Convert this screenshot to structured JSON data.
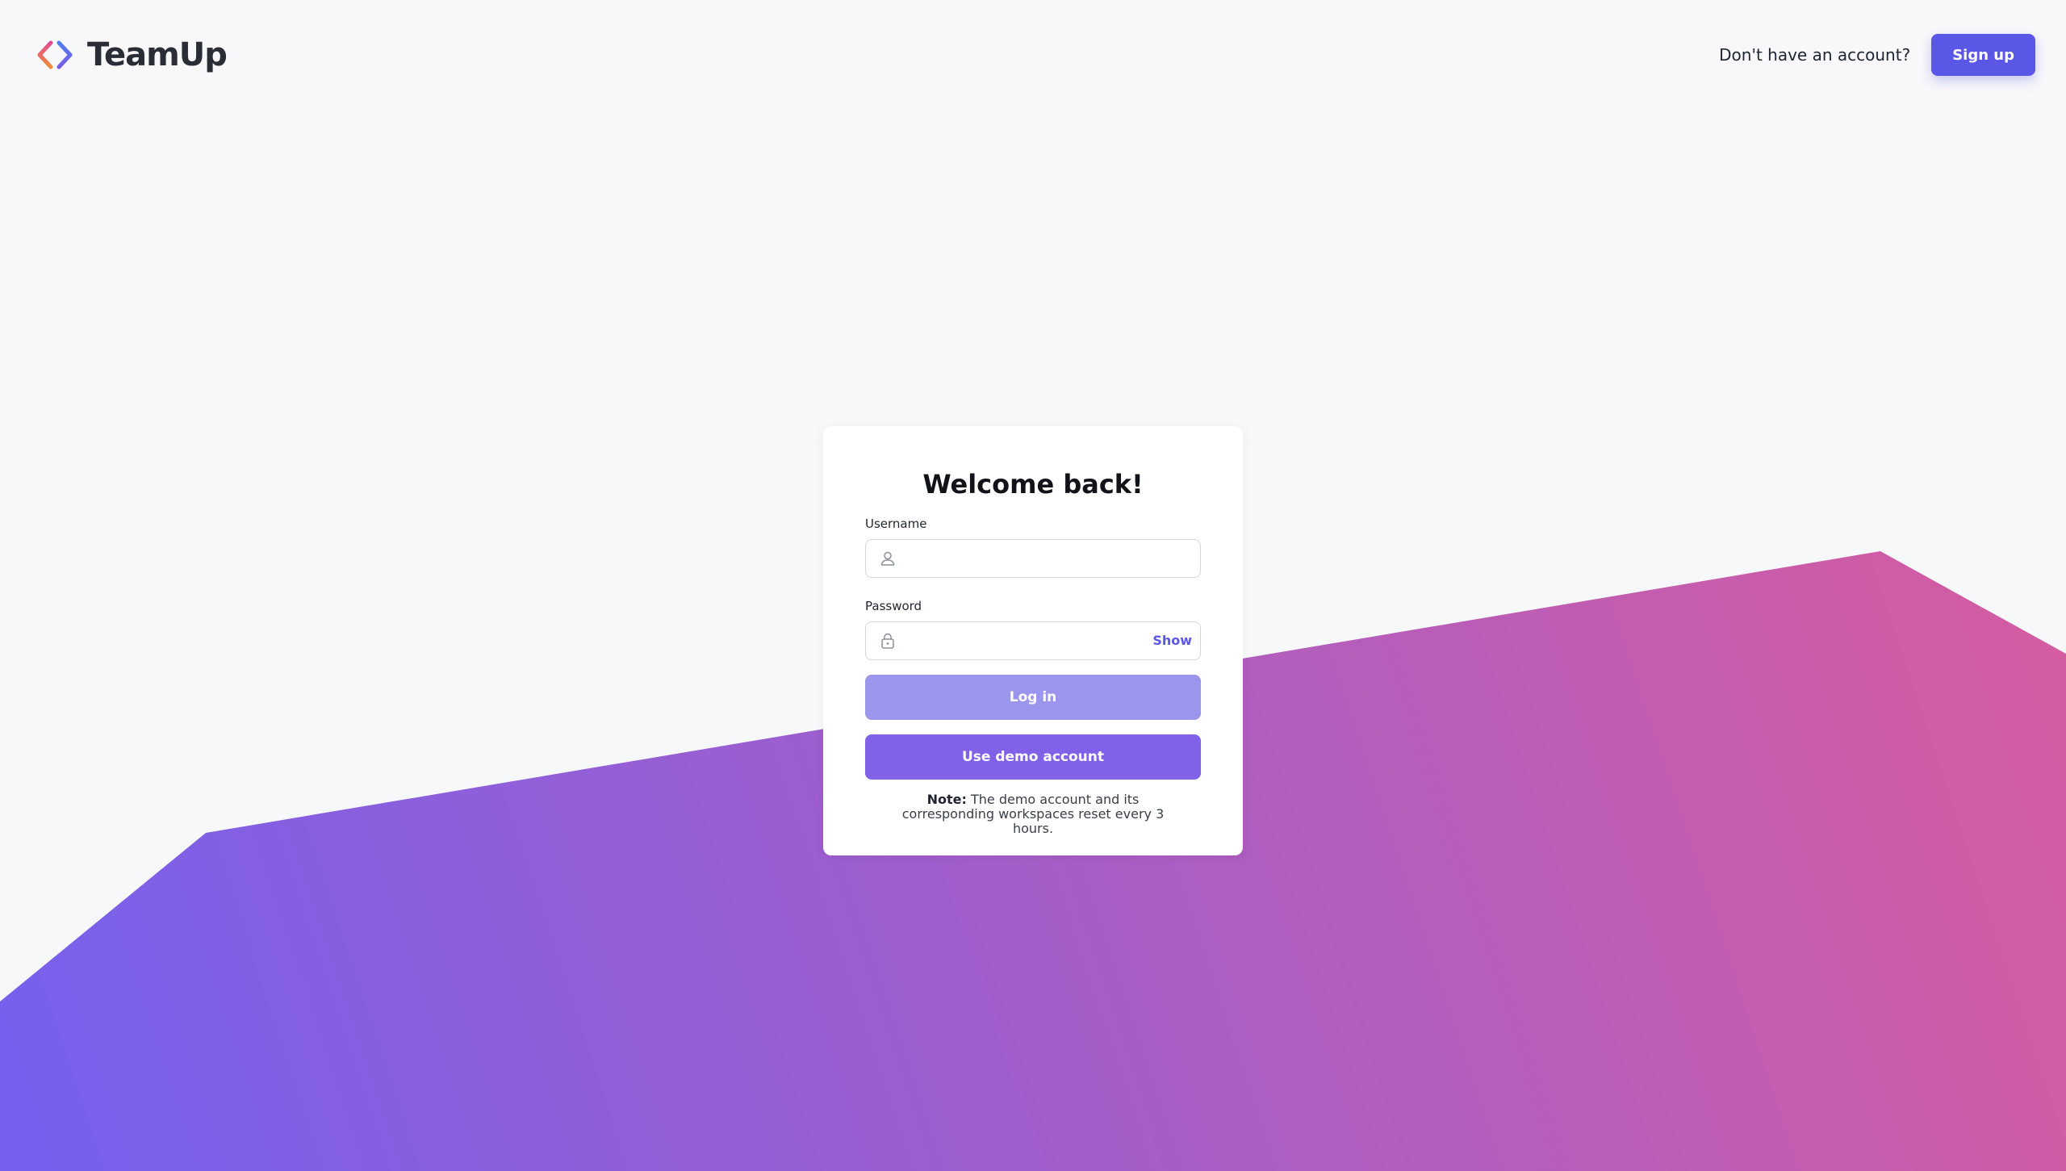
{
  "app": {
    "name": "TeamUp"
  },
  "header": {
    "account_prompt": "Don't have an account?",
    "signup_label": "Sign up"
  },
  "login": {
    "title": "Welcome back!",
    "username_label": "Username",
    "username_value": "",
    "password_label": "Password",
    "password_value": "",
    "show_label": "Show",
    "login_label": "Log in",
    "demo_label": "Use demo account",
    "note_prefix": "Note:",
    "note_text": "The demo account and its corresponding workspaces reset every 3 hours."
  },
  "colors": {
    "accent": "#5b57e6",
    "login_button_disabled": "#9b95ec",
    "demo_button": "#8161e8",
    "gradient_start": "#7560ef",
    "gradient_end": "#d75c9f",
    "background": "#f7f8fa"
  }
}
